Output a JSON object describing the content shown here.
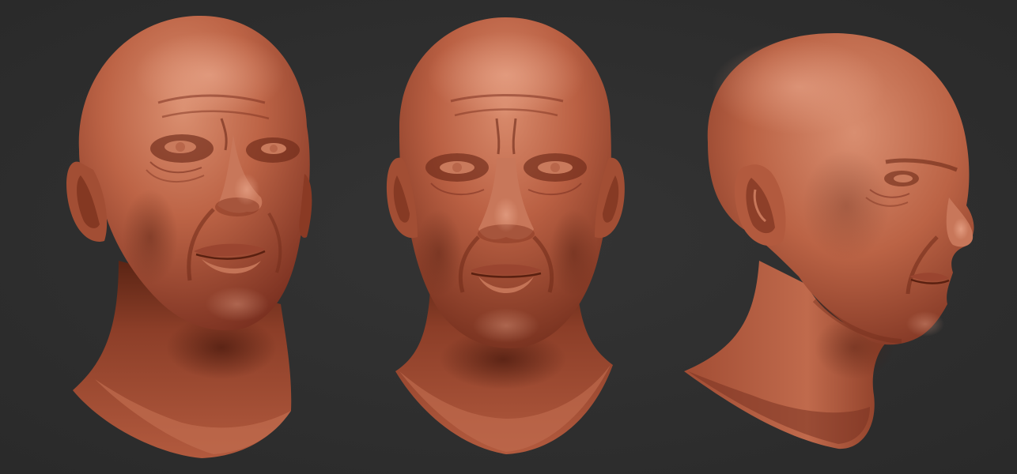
{
  "image": {
    "subject": "sculpted-heads",
    "background_color": "#2f2f2f",
    "clay_colors": {
      "highlight": "#d98b6c",
      "base": "#b45a3e",
      "shadow": "#6f2a18",
      "deep_shadow": "#4a1a0e"
    },
    "views": [
      {
        "name": "three-quarter-left",
        "order": 1
      },
      {
        "name": "front",
        "order": 2
      },
      {
        "name": "right-profile",
        "order": 3
      }
    ]
  }
}
